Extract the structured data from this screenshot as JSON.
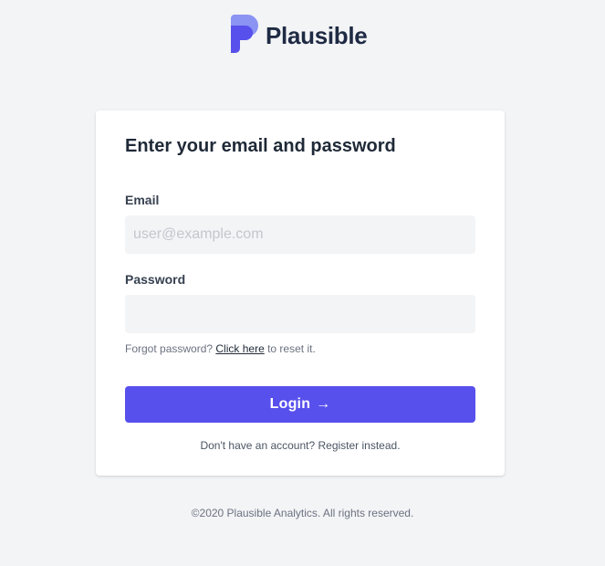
{
  "brand": {
    "name": "Plausible",
    "logo_icon": "plausible-logo-icon",
    "logo_colors": {
      "light": "#8b93f3",
      "dark": "#5850ec"
    }
  },
  "login_form": {
    "title": "Enter your email and password",
    "email": {
      "label": "Email",
      "placeholder": "user@example.com",
      "value": ""
    },
    "password": {
      "label": "Password",
      "placeholder": "",
      "value": ""
    },
    "forgot_password": {
      "prefix": "Forgot password? ",
      "link_text": "Click here",
      "suffix": " to reset it."
    },
    "submit": {
      "label": "Login",
      "icon": "arrow-right-icon",
      "arrow": "→",
      "color": "#5850ec"
    },
    "register": {
      "prefix": "Don't have an account? ",
      "link_text": "Register",
      "suffix": " instead."
    }
  },
  "footer": {
    "text": "©2020 Plausible Analytics. All rights reserved."
  }
}
